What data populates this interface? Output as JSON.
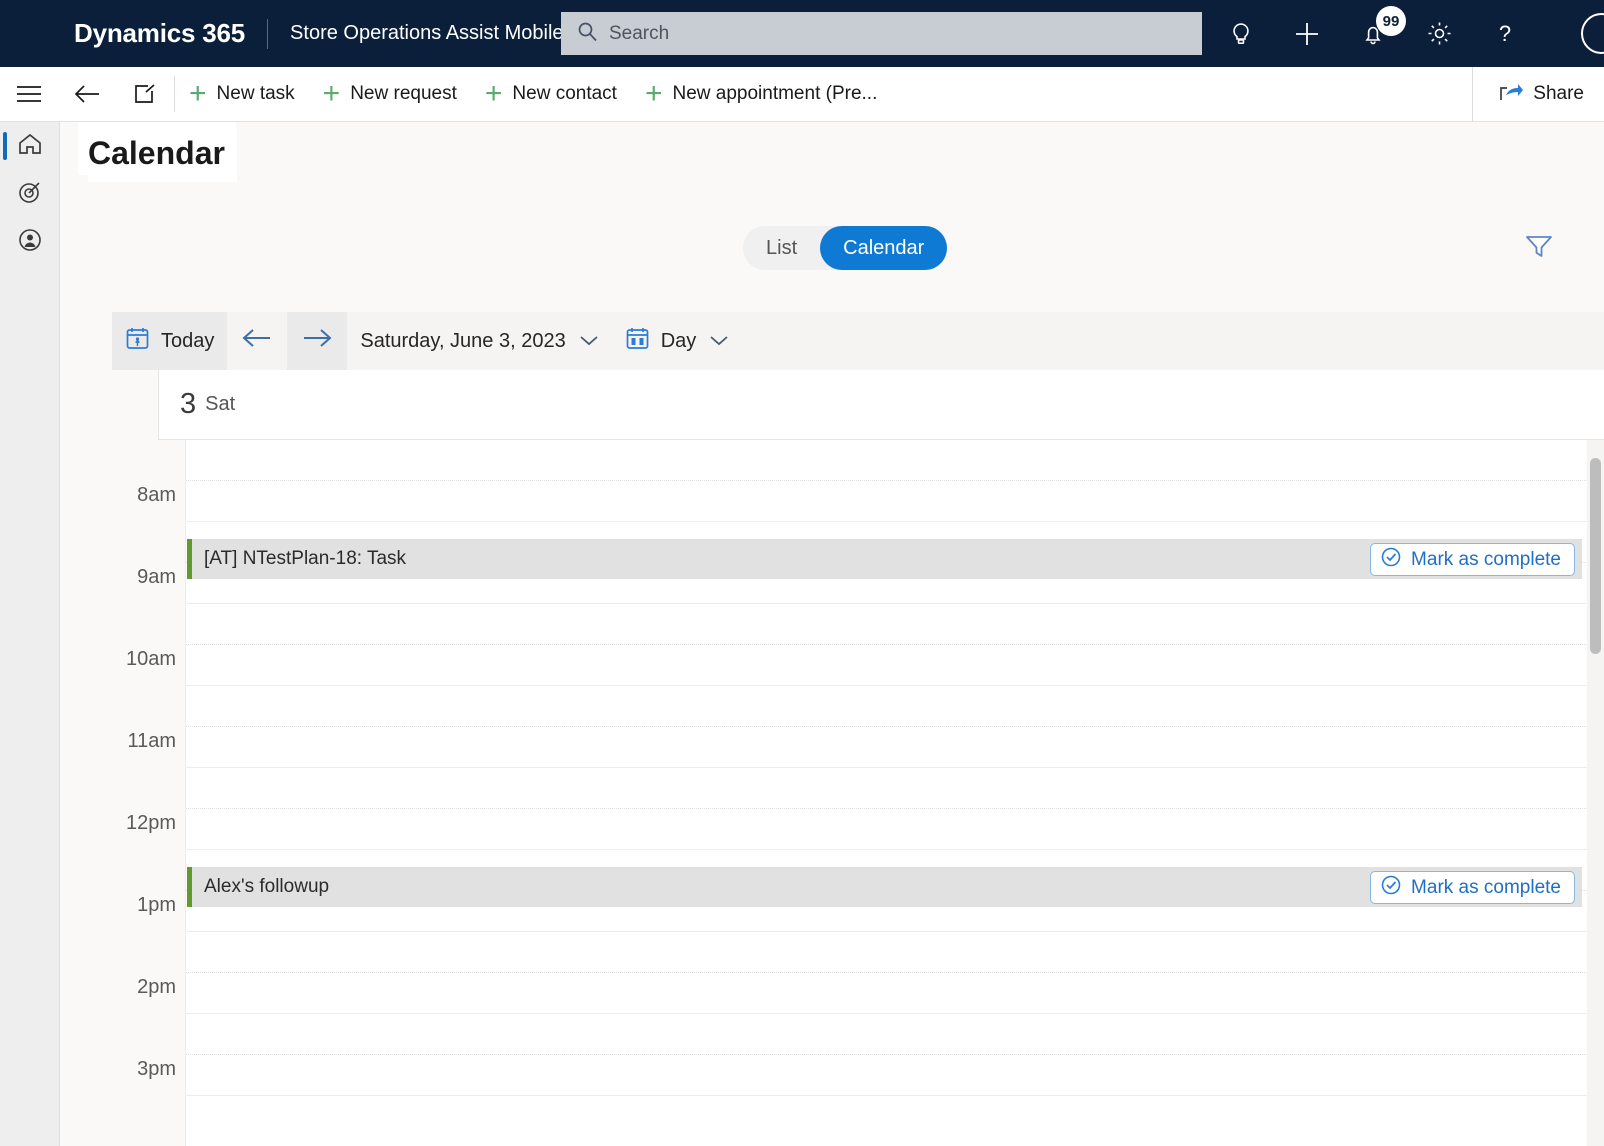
{
  "topnav": {
    "brand": "Dynamics 365",
    "app_name": "Store Operations Assist Mobile",
    "search_placeholder": "Search",
    "notification_badge": "99",
    "icons": [
      "lightbulb-icon",
      "plus-icon",
      "bell-icon",
      "gear-icon",
      "help-icon",
      "avatar-icon"
    ]
  },
  "commandbar": {
    "buttons": [
      {
        "label": "New task"
      },
      {
        "label": "New request"
      },
      {
        "label": "New contact"
      },
      {
        "label": "New appointment (Pre..."
      }
    ],
    "share_label": "Share"
  },
  "sidebar": {
    "items": [
      {
        "name": "home",
        "active": true
      },
      {
        "name": "pinned",
        "active": false
      },
      {
        "name": "contacts",
        "active": false
      }
    ]
  },
  "page": {
    "title": "Calendar"
  },
  "view_toggle": {
    "list_label": "List",
    "calendar_label": "Calendar",
    "selected": "Calendar"
  },
  "datebar": {
    "today_label": "Today",
    "prev_label": "Previous",
    "next_label": "Next",
    "current_date": "Saturday, June 3, 2023",
    "view_mode": "Day"
  },
  "day_header": {
    "day_number": "3",
    "day_of_week": "Sat"
  },
  "calendar": {
    "time_labels": [
      "8am",
      "9am",
      "10am",
      "11am",
      "12pm",
      "1pm",
      "2pm",
      "3pm"
    ],
    "events": [
      {
        "title": "[AT] NTestPlan-18: Task",
        "time": "9am",
        "action_label": "Mark as complete",
        "accent_color": "#5f9a2f"
      },
      {
        "title": "Alex's followup",
        "time": "1pm",
        "action_label": "Mark as complete",
        "accent_color": "#5f9a2f"
      }
    ]
  },
  "colors": {
    "nav_background": "#0b1f3a",
    "accent_blue": "#0f7ad4",
    "accent_green": "#5aab6e",
    "event_accent": "#5f9a2f"
  }
}
